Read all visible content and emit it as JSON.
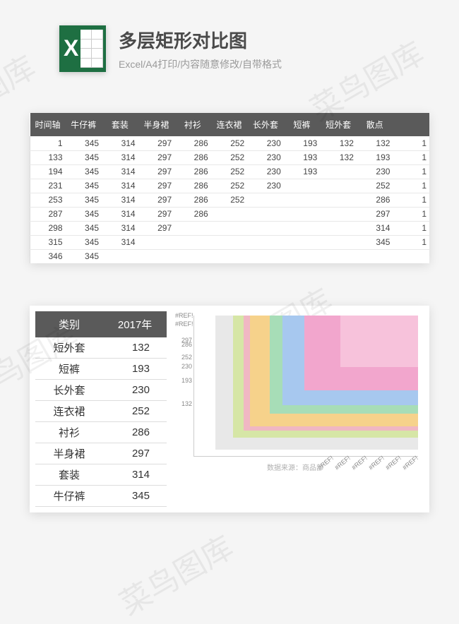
{
  "header": {
    "title": "多层矩形对比图",
    "subtitle": "Excel/A4打印/内容随意修改/自带格式"
  },
  "watermark": "菜鸟图库",
  "table1": {
    "headers": [
      "时间轴",
      "牛仔裤",
      "套装",
      "半身裙",
      "衬衫",
      "连衣裙",
      "长外套",
      "短裤",
      "短外套",
      "散点",
      ""
    ],
    "rows": [
      [
        "1",
        "345",
        "314",
        "297",
        "286",
        "252",
        "230",
        "193",
        "132",
        "132",
        "1"
      ],
      [
        "133",
        "345",
        "314",
        "297",
        "286",
        "252",
        "230",
        "193",
        "132",
        "193",
        "1"
      ],
      [
        "194",
        "345",
        "314",
        "297",
        "286",
        "252",
        "230",
        "193",
        "",
        "230",
        "1"
      ],
      [
        "231",
        "345",
        "314",
        "297",
        "286",
        "252",
        "230",
        "",
        "",
        "252",
        "1"
      ],
      [
        "253",
        "345",
        "314",
        "297",
        "286",
        "252",
        "",
        "",
        "",
        "286",
        "1"
      ],
      [
        "287",
        "345",
        "314",
        "297",
        "286",
        "",
        "",
        "",
        "",
        "297",
        "1"
      ],
      [
        "298",
        "345",
        "314",
        "297",
        "",
        "",
        "",
        "",
        "",
        "314",
        "1"
      ],
      [
        "315",
        "345",
        "314",
        "",
        "",
        "",
        "",
        "",
        "",
        "345",
        "1"
      ],
      [
        "346",
        "345",
        "",
        "",
        "",
        "",
        "",
        "",
        "",
        "",
        ""
      ]
    ]
  },
  "table2": {
    "headers": [
      "类别",
      "2017年"
    ],
    "rows": [
      [
        "短外套",
        "132"
      ],
      [
        "短裤",
        "193"
      ],
      [
        "长外套",
        "230"
      ],
      [
        "连衣裙",
        "252"
      ],
      [
        "衬衫",
        "286"
      ],
      [
        "半身裙",
        "297"
      ],
      [
        "套装",
        "314"
      ],
      [
        "牛仔裤",
        "345"
      ]
    ]
  },
  "chart_data": {
    "type": "bar",
    "title": "",
    "xlabel": "",
    "ylabel": "",
    "categories": [
      "短外套",
      "短裤",
      "长外套",
      "连衣裙",
      "衬衫",
      "半身裙",
      "套装",
      "牛仔裤"
    ],
    "values": [
      132,
      193,
      230,
      252,
      286,
      297,
      314,
      345
    ],
    "ylim": [
      0,
      360
    ],
    "y_ticks": [
      "#REF!",
      "#REF!",
      "297",
      "286",
      "252",
      "230",
      "193",
      "132"
    ],
    "x_ticks": [
      "#REF!",
      "#REF!",
      "#REF!",
      "#REF!",
      "#REF!",
      "#REF!"
    ],
    "colors": [
      "#f7c2db",
      "#f2a6cd",
      "#a7c8ef",
      "#a7ddb7",
      "#f6d28b",
      "#f0b7c3",
      "#d6e6a6",
      "#e8e8e8"
    ],
    "source": "数据来源：商品部"
  }
}
